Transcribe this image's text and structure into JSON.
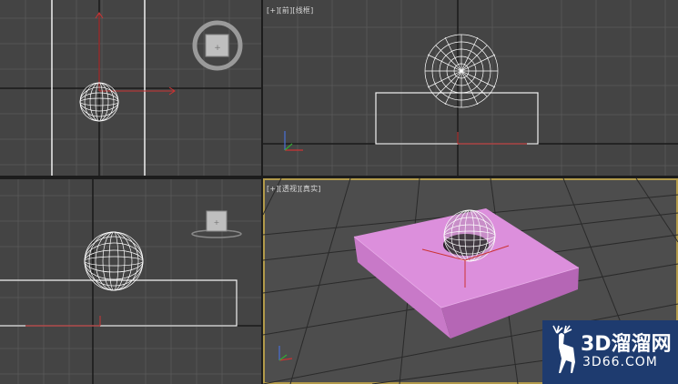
{
  "viewports": {
    "top": {
      "label": ""
    },
    "front": {
      "label": "[+][前][线框]"
    },
    "left": {
      "label": ""
    },
    "perspective": {
      "label": "[+][透视][真实]"
    }
  },
  "watermark": {
    "title": "3D溜溜网",
    "subtitle": "3D66.COM"
  },
  "colors": {
    "viewport_bg": "#444444",
    "grid": "#5a5a5a",
    "wireframe": "#ffffff",
    "box_fill": "#d98ad9",
    "active_border": "#b29a4a",
    "axis_red": "#cc3333",
    "watermark_bg": "#1e3b6f"
  },
  "icons": [
    "viewcube-icon",
    "deer-logo-icon"
  ]
}
